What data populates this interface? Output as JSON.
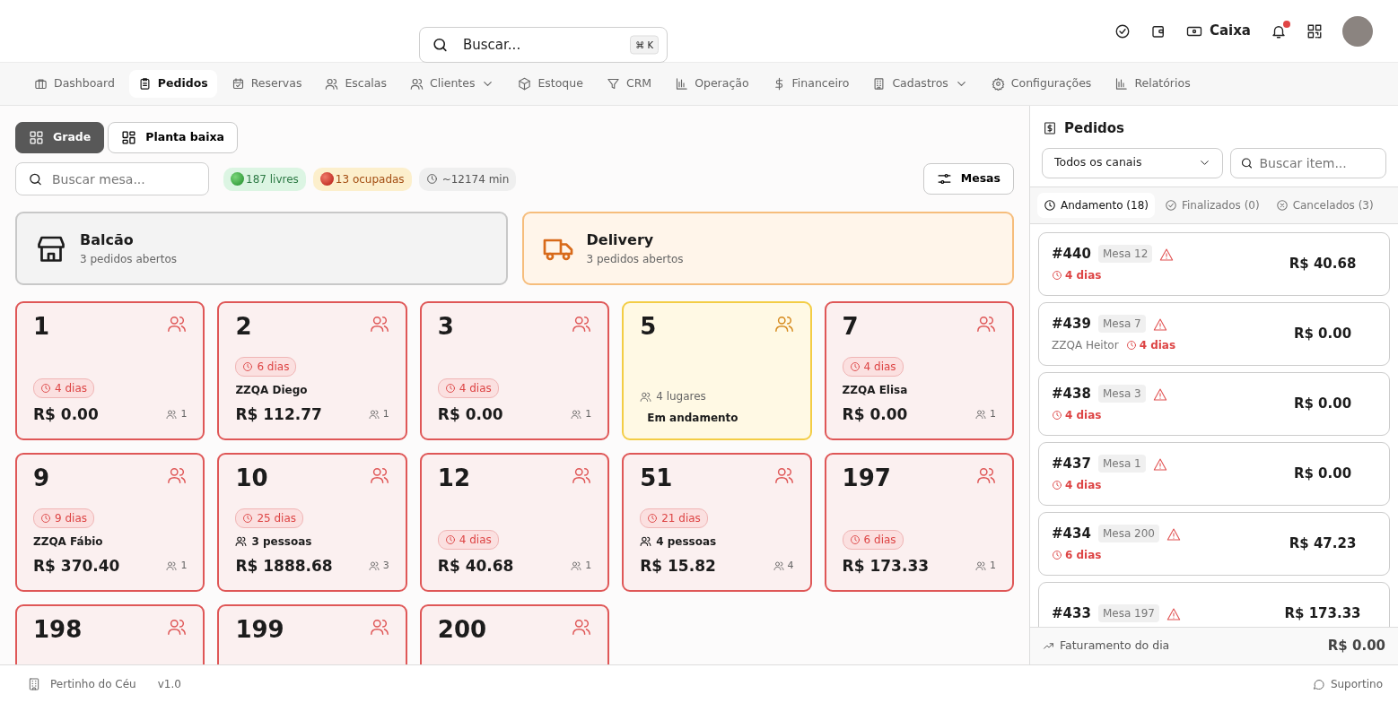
{
  "header": {
    "search": {
      "placeholder": "Buscar...",
      "shortcut": "⌘ K"
    },
    "cash_label": "Caixa",
    "notification_unread": true
  },
  "nav": [
    {
      "label": "Dashboard",
      "selected": false,
      "dropdown": false
    },
    {
      "label": "Pedidos",
      "selected": true,
      "dropdown": false
    },
    {
      "label": "Reservas",
      "selected": false,
      "dropdown": false
    },
    {
      "label": "Escalas",
      "selected": false,
      "dropdown": false
    },
    {
      "label": "Clientes",
      "selected": false,
      "dropdown": true
    },
    {
      "label": "Estoque",
      "selected": false,
      "dropdown": false
    },
    {
      "label": "CRM",
      "selected": false,
      "dropdown": false
    },
    {
      "label": "Operação",
      "selected": false,
      "dropdown": false
    },
    {
      "label": "Financeiro",
      "selected": false,
      "dropdown": false
    },
    {
      "label": "Cadastros",
      "selected": false,
      "dropdown": true
    },
    {
      "label": "Configurações",
      "selected": false,
      "dropdown": false
    },
    {
      "label": "Relatórios",
      "selected": false,
      "dropdown": false
    }
  ],
  "view_toggle": [
    {
      "label": "Grade",
      "selected": true
    },
    {
      "label": "Planta baixa",
      "selected": false
    }
  ],
  "table_search": {
    "placeholder": "Buscar mesa..."
  },
  "stats": [
    {
      "label": "187 livres",
      "kind": "free"
    },
    {
      "label": "13 ocupadas",
      "kind": "occupied"
    },
    {
      "label": "~12174 min",
      "kind": "time"
    }
  ],
  "mesas_button": "Mesas",
  "channels": [
    {
      "title": "Balcão",
      "subtitle": "3 pedidos abertos",
      "kind": "counter"
    },
    {
      "title": "Delivery",
      "subtitle": "3 pedidos abertos",
      "kind": "delivery"
    }
  ],
  "tables": [
    {
      "number": "1",
      "kind": "occupied",
      "duration": "4 dias",
      "total": "R$ 0.00",
      "people": "1"
    },
    {
      "number": "2",
      "kind": "occupied",
      "duration": "6 dias",
      "customer": "ZZQA Diego",
      "total": "R$ 112.77",
      "people": "1"
    },
    {
      "number": "3",
      "kind": "occupied",
      "duration": "4 dias",
      "total": "R$ 0.00",
      "people": "1"
    },
    {
      "number": "5",
      "kind": "in_progress",
      "seats": "4 lugares",
      "status": "Em andamento"
    },
    {
      "number": "7",
      "kind": "occupied",
      "duration": "4 dias",
      "customer": "ZZQA Elisa",
      "total": "R$ 0.00",
      "people": "1"
    },
    {
      "number": "9",
      "kind": "occupied",
      "duration": "9 dias",
      "customer": "ZZQA Fábio",
      "total": "R$ 370.40",
      "people": "1"
    },
    {
      "number": "10",
      "kind": "occupied",
      "duration": "25 dias",
      "guests": "3 pessoas",
      "total": "R$ 1888.68",
      "people": "3"
    },
    {
      "number": "12",
      "kind": "occupied",
      "duration": "4 dias",
      "total": "R$ 40.68",
      "people": "1"
    },
    {
      "number": "51",
      "kind": "occupied",
      "duration": "21 dias",
      "guests": "4 pessoas",
      "total": "R$ 15.82",
      "people": "4"
    },
    {
      "number": "197",
      "kind": "occupied",
      "duration": "6 dias",
      "total": "R$ 173.33",
      "people": "1"
    },
    {
      "number": "198",
      "kind": "occupied"
    },
    {
      "number": "199",
      "kind": "occupied"
    },
    {
      "number": "200",
      "kind": "occupied"
    }
  ],
  "orders_panel": {
    "title": "Pedidos",
    "channel_select": "Todos os canais",
    "search_placeholder": "Buscar item...",
    "tabs": [
      {
        "label": "Andamento (18)",
        "kind": "progress",
        "selected": true
      },
      {
        "label": "Finalizados (0)",
        "kind": "done",
        "selected": false
      },
      {
        "label": "Cancelados (3)",
        "kind": "cancelled",
        "selected": false
      }
    ],
    "orders": [
      {
        "number": "#440",
        "table": "Mesa 12",
        "duration": "4 dias",
        "total": "R$ 40.68"
      },
      {
        "number": "#439",
        "table": "Mesa 7",
        "customer": "ZZQA Heitor",
        "duration": "4 dias",
        "total": "R$ 0.00"
      },
      {
        "number": "#438",
        "table": "Mesa 3",
        "duration": "4 dias",
        "total": "R$ 0.00"
      },
      {
        "number": "#437",
        "table": "Mesa 1",
        "duration": "4 dias",
        "total": "R$ 0.00"
      },
      {
        "number": "#434",
        "table": "Mesa 200",
        "duration": "6 dias",
        "total": "R$ 47.23"
      },
      {
        "number": "#433",
        "table": "Mesa 197",
        "total": "R$ 173.33"
      }
    ],
    "revenue_label": "Faturamento do dia",
    "revenue": "R$ 0.00"
  },
  "footer": {
    "company": "Pertinho do Céu",
    "version": "v1.0",
    "support": "Suportino"
  }
}
